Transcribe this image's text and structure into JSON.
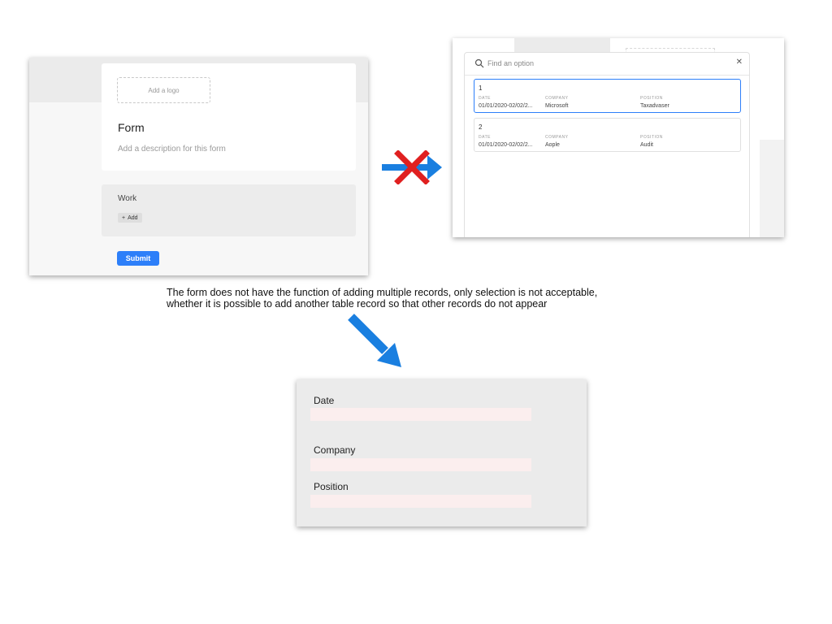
{
  "form_screenshot": {
    "logo_placeholder": "Add a logo",
    "title": "Form",
    "description_placeholder": "Add a description for this form",
    "section_label": "Work",
    "add_label": "Add",
    "submit_label": "Submit"
  },
  "picker_screenshot": {
    "search_placeholder": "Find an option",
    "column_headers": [
      "DATE",
      "COMPANY",
      "POSITION"
    ],
    "options": [
      {
        "number": "1",
        "date": "01/01/2020-02/02/2...",
        "company": "Microsoft",
        "position": "Taxadvaser"
      },
      {
        "number": "2",
        "date": "01/01/2020-02/02/2...",
        "company": "Aople",
        "position": "Audit"
      }
    ]
  },
  "note": {
    "line1": "The form does not have the function of adding multiple records, only selection is not acceptable,",
    "line2": "whether it is possible to add another table record so that other records do not appear"
  },
  "mock_form": {
    "fields": [
      "Date",
      "Company",
      "Position"
    ]
  },
  "colors": {
    "accent_blue": "#2d7ff9",
    "arrow_blue": "#1a7fe0",
    "cross_red": "#e02020",
    "mock_input_bg": "#fbeeee"
  }
}
